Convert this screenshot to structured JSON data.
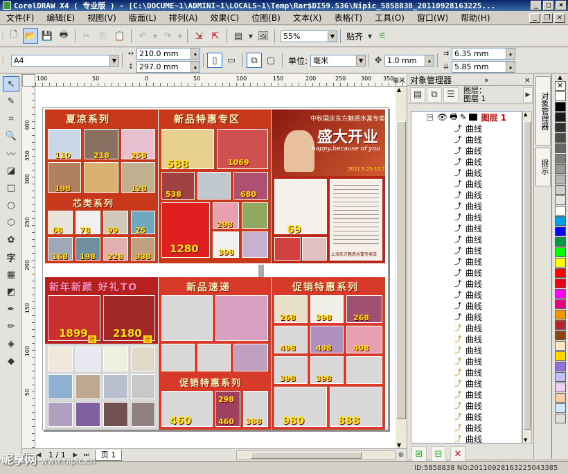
{
  "window": {
    "title": "CorelDRAW X4 ( 专业版 ) - [C:\\DOCUME~1\\ADMINI~1\\LOCALS~1\\Temp\\Rar$DI59.536\\Nipic_5858838_20110928163225..."
  },
  "menu": [
    "文件(F)",
    "编辑(E)",
    "视图(V)",
    "版面(L)",
    "排列(A)",
    "效果(C)",
    "位图(B)",
    "文本(X)",
    "表格(T)",
    "工具(O)",
    "窗口(W)",
    "帮助(H)"
  ],
  "toolbar": {
    "zoom": "55%",
    "snap_label": "贴齐"
  },
  "propbar": {
    "paper": "A4",
    "width": "210.0 mm",
    "height": "297.0 mm",
    "unit_label": "单位:",
    "unit": "毫米",
    "nudge": "1.0 mm",
    "dup_x": "6.35 mm",
    "dup_y": "5.85 mm"
  },
  "rulers": {
    "h": [
      "100",
      "50",
      "0",
      "50",
      "100",
      "150",
      "200",
      "250",
      "300",
      "350"
    ],
    "h_unit": "毫米",
    "v": [
      "400",
      "350",
      "300",
      "250",
      "200",
      "150",
      "100",
      "50"
    ]
  },
  "flyers": {
    "p1": {
      "title": "夏凉系列",
      "subtitle": "芯类系列",
      "prices": [
        "110",
        "218",
        "258",
        "198",
        "128",
        "68",
        "78",
        "99",
        "25",
        "168",
        "198",
        "228",
        "338"
      ]
    },
    "p2": {
      "title": "新品特惠专区",
      "prices": [
        "588",
        "1069",
        "538",
        "680",
        "298",
        "1280",
        "398"
      ]
    },
    "p3": {
      "banner": "中秋国庆东方魅惑水富专卖店",
      "headline": "盛大开业",
      "tagline": "happy,because of you",
      "date": "2011.9.25-10.7",
      "price": "69",
      "footer": "上海东方魅惑水富专卖店"
    },
    "p4": {
      "title": "新年新颜 好礼TO",
      "prices": [
        "1899",
        "2180"
      ],
      "badge": "送"
    },
    "p5": {
      "title": "新品速递",
      "subtitle": "促销特惠系列",
      "prices": [
        "460",
        "460",
        "388",
        "298"
      ]
    },
    "p6": {
      "title": "促销特惠系列",
      "prices": [
        "268",
        "398",
        "268",
        "498",
        "498",
        "498",
        "398",
        "398",
        "980",
        "888"
      ]
    }
  },
  "page_nav": {
    "counter": "1 / 1",
    "page_tab": "页 1"
  },
  "docker": {
    "title": "对象管理器",
    "layer_info": [
      "图层：",
      "图层 1"
    ],
    "layer_name": "图层 1",
    "object_label": "曲线",
    "objects": [
      "曲线",
      "曲线",
      "曲线",
      "曲线",
      "曲线",
      "曲线",
      "曲线",
      "曲线",
      "曲线",
      "曲线",
      "曲线",
      "曲线",
      "曲线",
      "曲线",
      "曲线",
      "曲线",
      "曲线",
      "曲线",
      "曲线",
      "曲线",
      "曲线",
      "曲线",
      "曲线",
      "曲线",
      "曲线",
      "曲线",
      "曲线",
      "曲线",
      "曲线"
    ]
  },
  "side_tabs": [
    "对象管理器",
    "提示"
  ],
  "palette": [
    "#ffffff",
    "#000000",
    "#1a1a1a",
    "#333333",
    "#4d4d4d",
    "#666666",
    "#808080",
    "#999999",
    "#b3b3b3",
    "#cccccc",
    "#e6e6e6",
    "#ffffff",
    "#00a0e9",
    "#0000ff",
    "#009944",
    "#00ff00",
    "#ffff00",
    "#ff0000",
    "#e60012",
    "#ff00ff",
    "#e4007f",
    "#f39800",
    "#b4282e",
    "#8b4513",
    "#ffe4c4",
    "#ffd700",
    "#9370db",
    "#c0c0ff",
    "#f0d0f0",
    "#ffccaa",
    "#d0e8ff",
    "#e0e0e0"
  ],
  "watermark": {
    "logo": "昵享网",
    "url": "www.nipic.cn",
    "id": "ID:5858838 NO:20110928163225043385"
  }
}
